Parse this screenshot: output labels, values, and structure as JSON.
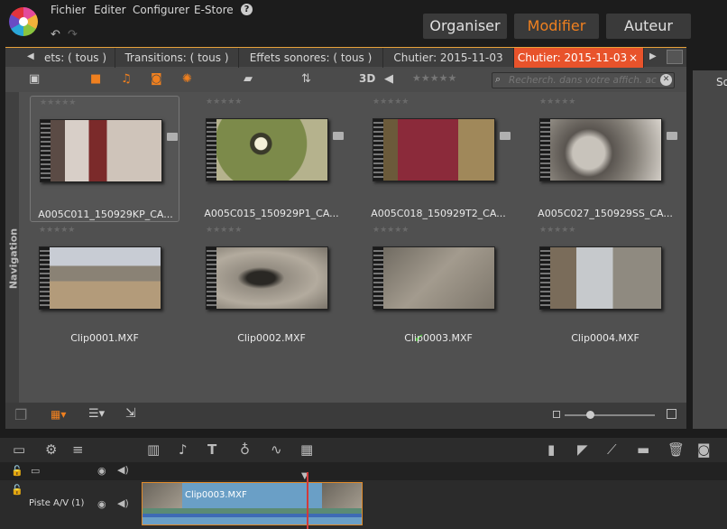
{
  "menu": {
    "items": [
      "Fichier",
      "Editer",
      "Configurer",
      "E-Store"
    ],
    "help": "?"
  },
  "modes": {
    "organiser": "Organiser",
    "modifier": "Modifier",
    "auteur": "Auteur",
    "active": "Modifier",
    "active_color": "#f0801f"
  },
  "tabs": [
    {
      "label": "ets: ( tous )"
    },
    {
      "label": "Transitions: ( tous )"
    },
    {
      "label": "Effets sonores: ( tous )"
    },
    {
      "label": "Chutier: 2015-11-03"
    },
    {
      "label": "Chutier: 2015-11-03",
      "active": true,
      "close": "×"
    }
  ],
  "toolbar": {
    "threed": "3D",
    "search_placeholder": "Recherch. dans votre affich. ac"
  },
  "nav": {
    "label": "Navigation"
  },
  "clips": [
    {
      "name": "A005C011_150929KP_CA...",
      "thumb": "house"
    },
    {
      "name": "A005C015_150929P1_CA...",
      "thumb": "lantern"
    },
    {
      "name": "A005C018_150929T2_CA...",
      "thumb": "gate"
    },
    {
      "name": "A005C027_150929SS_CA...",
      "thumb": "cat"
    },
    {
      "name": "Clip0001.MXF",
      "thumb": "field"
    },
    {
      "name": "Clip0002.MXF",
      "thumb": "stone"
    },
    {
      "name": "Clip0003.MXF",
      "thumb": "rock"
    },
    {
      "name": "Clip0004.MXF",
      "thumb": "street"
    }
  ],
  "right_label": "So",
  "timeline": {
    "track_name": "Piste A/V (1)",
    "clip_label": "Clip0003.MXF"
  },
  "colors": {
    "accent": "#f0801f",
    "active_tab": "#e8532b",
    "check": "#4cba3c"
  }
}
